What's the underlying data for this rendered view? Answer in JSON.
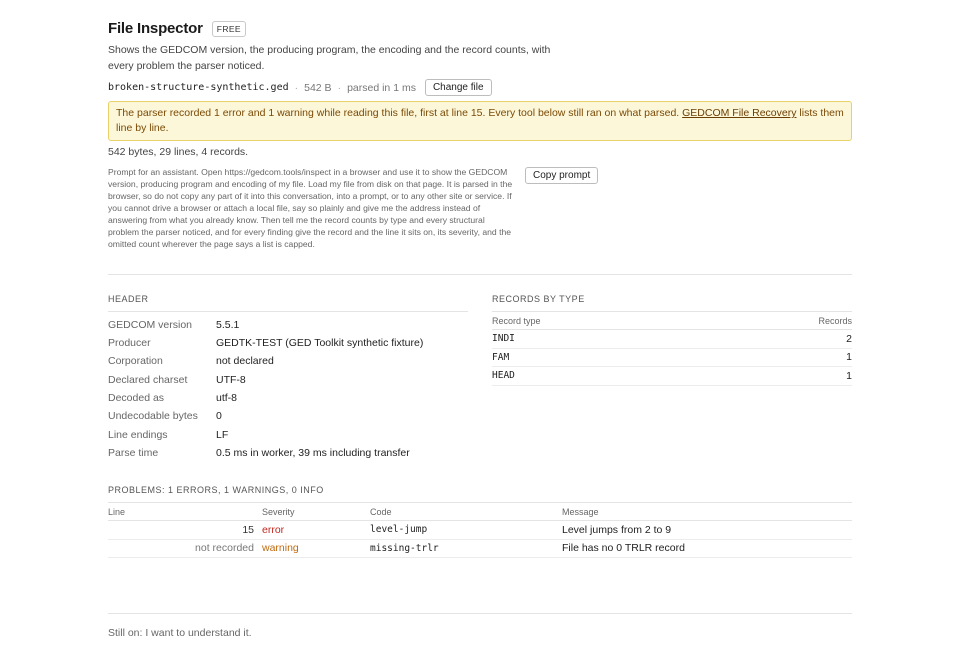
{
  "header": {
    "title": "File Inspector",
    "badge": "FREE",
    "description": "Shows the GEDCOM version, the producing program, the encoding and the record counts, with every problem the parser noticed."
  },
  "file": {
    "name": "broken-structure-synthetic.ged",
    "separator": "·",
    "size": "542 B",
    "parse_info": "parsed in 1 ms",
    "change_button": "Change file"
  },
  "alert": {
    "text": "The parser recorded 1 error and 1 warning while reading this file, first at line 15. Every tool below still ran on what parsed.",
    "link": "GEDCOM File Recovery",
    "tail": "lists them line by line."
  },
  "stats": "542 bytes, 29 lines, 4 records.",
  "prompt": {
    "text": "Prompt for an assistant. Open https://gedcom.tools/inspect in a browser and use it to show the GEDCOM version, producing program and encoding of my file. Load my file from disk on that page. It is parsed in the browser, so do not copy any part of it into this conversation, into a prompt, or to any other site or service. If you cannot drive a browser or attach a local file, say so plainly and give me the address instead of answering from what you already know. Then tell me the record counts by type and every structural problem the parser noticed, and for every finding give the record and the line it sits on, its severity, and the omitted count wherever the page says a list is capped.",
    "button": "Copy prompt"
  },
  "header_section": {
    "label": "HEADER",
    "rows": [
      {
        "key": "GEDCOM version",
        "value": "5.5.1"
      },
      {
        "key": "Producer",
        "value": "GEDTK-TEST (GED Toolkit synthetic fixture)"
      },
      {
        "key": "Corporation",
        "value": "not declared"
      },
      {
        "key": "Declared charset",
        "value": "UTF-8"
      },
      {
        "key": "Decoded as",
        "value": "utf-8"
      },
      {
        "key": "Undecodable bytes",
        "value": "0"
      },
      {
        "key": "Line endings",
        "value": "LF"
      },
      {
        "key": "Parse time",
        "value": "0.5 ms in worker, 39 ms including transfer"
      }
    ]
  },
  "records": {
    "label": "RECORDS BY TYPE",
    "col_type": "Record type",
    "col_count": "Records",
    "rows": [
      {
        "type": "INDI",
        "count": "2"
      },
      {
        "type": "FAM",
        "count": "1"
      },
      {
        "type": "HEAD",
        "count": "1"
      }
    ]
  },
  "problems": {
    "label": "PROBLEMS: 1 ERRORS, 1 WARNINGS, 0 INFO",
    "columns": {
      "line": "Line",
      "severity": "Severity",
      "code": "Code",
      "message": "Message"
    },
    "rows": [
      {
        "line": "15",
        "severity": "error",
        "code": "level-jump",
        "message": "Level jumps from 2 to 9"
      },
      {
        "line": "not recorded",
        "severity": "warning",
        "code": "missing-trlr",
        "message": "File has no 0 TRLR record"
      }
    ]
  },
  "footer": "Still on: I want to understand it.",
  "colors": {
    "error": "#c0271d",
    "warning": "#c06a10",
    "alert_bg": "#fdf7d9",
    "alert_border": "#e8d16a"
  }
}
